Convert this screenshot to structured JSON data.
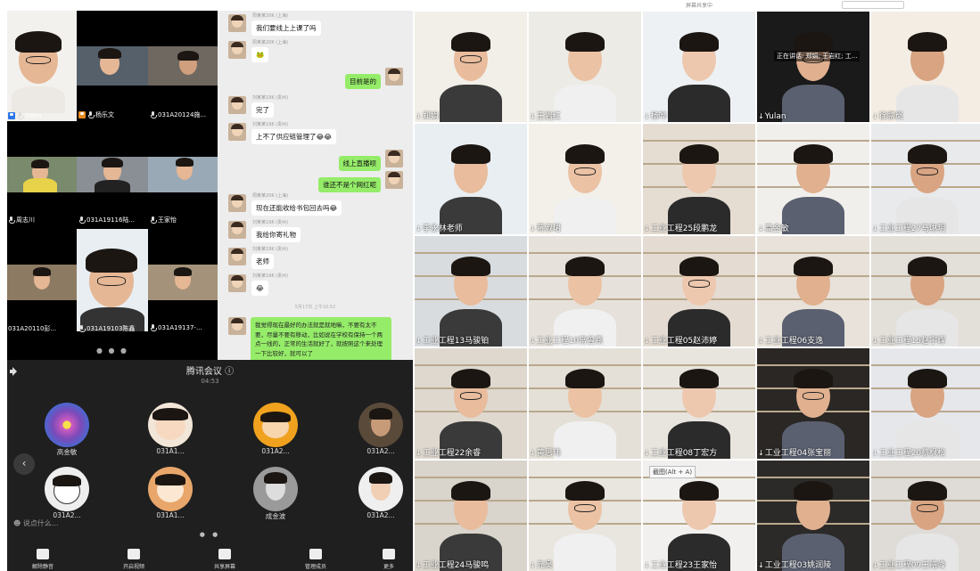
{
  "top_left_grid": {
    "tiles": [
      "Yulan",
      "杨乐文",
      "031A20124施...",
      "周志川",
      "031A19116陆...",
      "王家怡",
      "031A20110彭...",
      "031A19103陈鑫",
      "031A19137-..."
    ],
    "pager_dots": "● ● ●"
  },
  "chat": {
    "messages": [
      {
        "name": "周某某20K (上海)",
        "text": "我们要线上上课了吗",
        "side": "left"
      },
      {
        "name": "周某某20K (上海)",
        "text": "🐸",
        "side": "left"
      },
      {
        "name": "",
        "text": "目前是的",
        "side": "right"
      },
      {
        "name": "刘某某19K (贵州)",
        "text": "完了",
        "side": "left"
      },
      {
        "name": "刘某某19K (贵州)",
        "text": "上不了供应链管理了😂😂",
        "side": "left"
      },
      {
        "name": "",
        "text": "线上直播呗",
        "side": "right"
      },
      {
        "name": "",
        "text": "谁还不是个网红呢",
        "side": "right"
      },
      {
        "name": "周某某20K (上海)",
        "text": "现在还能收给书包回去吗😂",
        "side": "left"
      },
      {
        "name": "刘某某19K (贵州)",
        "text": "我给你寄礼物",
        "side": "left"
      },
      {
        "name": "刘某某19K (贵州)",
        "text": "老师",
        "side": "left"
      },
      {
        "name": "刘某某19K (贵州)",
        "text": "😂",
        "side": "left"
      }
    ],
    "timestamp": "5月17日 上午10:52",
    "long_message": "我觉得现在最好的办法就是就地嘛，不要有太不要，尽量不要有移动，比如说在学校有保持一个两点一线的，正常的生活就好了，就按照这个来处理一下比较好，就可以了"
  },
  "mobile_meeting": {
    "title": "腾讯会议 ⓘ",
    "time": "04:53",
    "participants": [
      "高金敏",
      "031A1...",
      "031A2...",
      "031A2...",
      "031A2...",
      "031A1...",
      "成金波",
      "031A2..."
    ],
    "chat_placeholder": "说点什么...",
    "toolbar": [
      "解除静音",
      "开启视频",
      "共享屏幕",
      "管理成员",
      "更多"
    ],
    "pager_dots": "● ●"
  },
  "right_grid": {
    "top_strip_text": "屏幕共享中",
    "tiles": [
      "郑娟",
      "王岩红",
      "杨哗",
      "Yulan",
      "徐鹏岚",
      "李永林老师",
      "蒋淑珺",
      "工业工程25段鹏龙",
      "高金敏",
      "工业工程27马琳玥",
      "工业工程13马骏铂",
      "工业工程10常曾燕",
      "工业工程05赵沛婷",
      "工业工程06支逸",
      "工业工程15赵宇辉",
      "工业工程22余睿",
      "黄思玮",
      "工业工程08丁宏方",
      "工业工程04张宝丽",
      "工业工程20蔡枫松",
      "工业工程24马骏鸣",
      "元昊",
      "工业工程23王家怡",
      "工业工程03姚润陵",
      "工业工程09王皓峰"
    ],
    "overlay_text": "正在讲话: 郑娟; 王岩红; 工...",
    "tooltip": "截图(Alt + A)"
  }
}
